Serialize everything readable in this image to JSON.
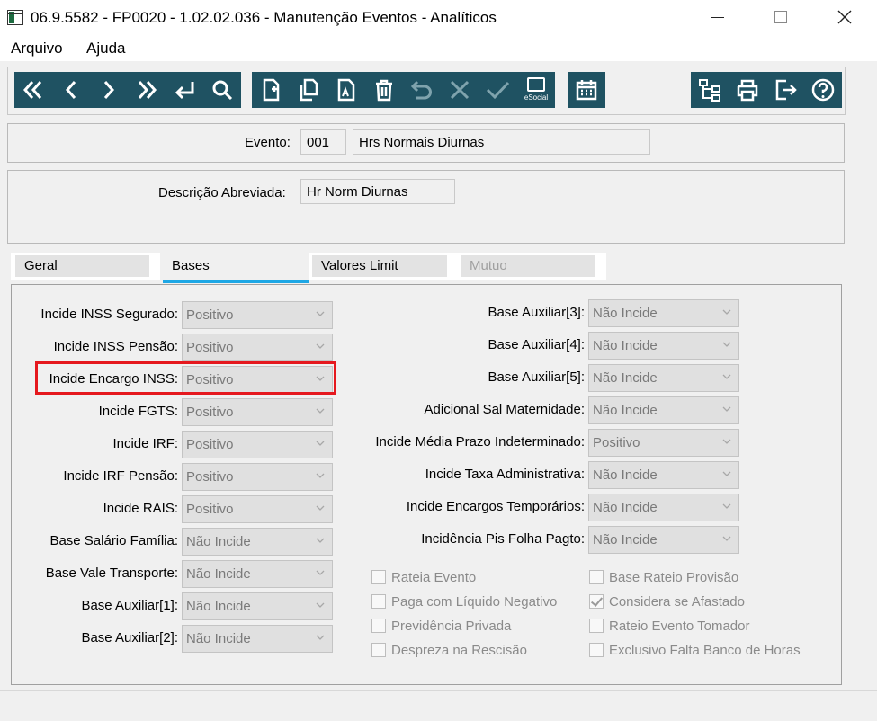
{
  "window": {
    "title": "06.9.5582 - FP0020 - 1.02.02.036 - Manutenção Eventos - Analíticos",
    "minimize_icon": "minimize-icon",
    "maximize_icon": "maximize-icon",
    "close_icon": "close-icon"
  },
  "menu": {
    "file": "Arquivo",
    "help": "Ajuda"
  },
  "toolbar": {
    "color": "#1f5262",
    "nav": [
      "first-icon",
      "previous-icon",
      "next-icon",
      "last-icon",
      "enter-icon",
      "search-icon"
    ],
    "edit": [
      "new-icon",
      "copy-icon",
      "edit-icon",
      "delete-icon",
      "undo-icon",
      "cancel-icon",
      "confirm-icon"
    ],
    "esocial_label": "eSocial",
    "calendar": "calendar-icon",
    "right": [
      "tree-icon",
      "print-icon",
      "exit-icon",
      "help-icon"
    ]
  },
  "header": {
    "event_label": "Evento:",
    "event_code": "001",
    "event_name": "Hrs Normais Diurnas",
    "short_desc_label": "Descrição Abreviada:",
    "short_desc_value": "Hr Norm Diurnas"
  },
  "tabs": [
    {
      "label": "Geral"
    },
    {
      "label": "Bases"
    },
    {
      "label": "Valores Limit"
    },
    {
      "label": "Mutuo"
    }
  ],
  "accent_color": "#1ea7e5",
  "highlight_color": "#e5181e",
  "left_fields": [
    {
      "label": "Incide INSS Segurado:",
      "value": "Positivo"
    },
    {
      "label": "Incide INSS Pensão:",
      "value": "Positivo"
    },
    {
      "label": "Incide Encargo INSS:",
      "value": "Positivo"
    },
    {
      "label": "Incide FGTS:",
      "value": "Positivo"
    },
    {
      "label": "Incide IRF:",
      "value": "Positivo"
    },
    {
      "label": "Incide IRF Pensão:",
      "value": "Positivo"
    },
    {
      "label": "Incide RAIS:",
      "value": "Positivo"
    },
    {
      "label": "Base Salário Família:",
      "value": "Não Incide"
    },
    {
      "label": "Base Vale Transporte:",
      "value": "Não Incide"
    },
    {
      "label": "Base Auxiliar[1]:",
      "value": "Não Incide"
    },
    {
      "label": "Base Auxiliar[2]:",
      "value": "Não Incide"
    }
  ],
  "right_fields": [
    {
      "label": "Base Auxiliar[3]:",
      "value": "Não Incide"
    },
    {
      "label": "Base Auxiliar[4]:",
      "value": "Não Incide"
    },
    {
      "label": "Base Auxiliar[5]:",
      "value": "Não Incide"
    },
    {
      "label": "Adicional Sal Maternidade:",
      "value": "Não Incide"
    },
    {
      "label": "Incide Média Prazo Indeterminado:",
      "value": "Positivo"
    },
    {
      "label": "Incide Taxa Administrativa:",
      "value": "Não Incide"
    },
    {
      "label": "Incide Encargos Temporários:",
      "value": "Não Incide"
    },
    {
      "label": "Incidência Pis Folha Pagto:",
      "value": "Não Incide"
    }
  ],
  "checkboxes_left": [
    {
      "label": "Rateia Evento",
      "checked": false
    },
    {
      "label": "Paga com Líquido Negativo",
      "checked": false
    },
    {
      "label": "Previdência Privada",
      "checked": false
    },
    {
      "label": "Despreza na Rescisão",
      "checked": false
    }
  ],
  "checkboxes_right": [
    {
      "label": "Base Rateio Provisão",
      "checked": false
    },
    {
      "label": "Considera se Afastado",
      "checked": true
    },
    {
      "label": "Rateio Evento Tomador",
      "checked": false
    },
    {
      "label": "Exclusivo Falta Banco de Horas",
      "checked": false
    }
  ]
}
